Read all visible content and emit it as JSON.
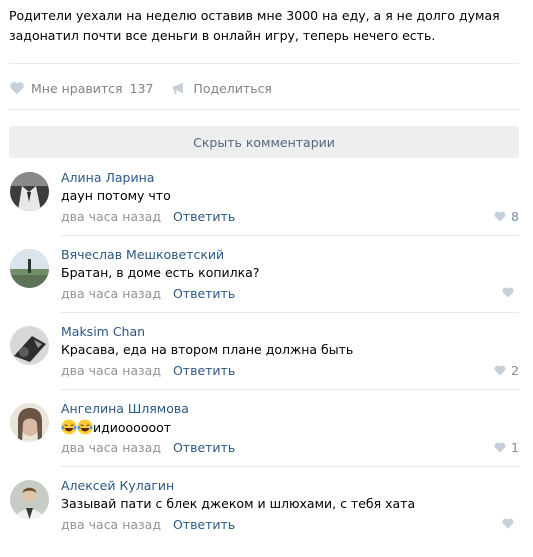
{
  "post": {
    "text_line1": "Родители уехали на неделю оставив мне 3000 на еду, а я не долго думая",
    "text_line2": "задонатил почти все деньги в онлайн игру, теперь нечего есть."
  },
  "actions": {
    "like_label": "Мне нравится",
    "like_count": "137",
    "share_label": "Поделиться"
  },
  "hide_comments_label": "Скрыть комментарии",
  "comments": [
    {
      "author": "Алина Ларина",
      "text": "даун потому что",
      "time": "два часа назад",
      "reply": "Ответить",
      "likes": "8"
    },
    {
      "author": "Вячеслав Мешковетский",
      "text": "Братан, в доме есть копилка?",
      "time": "два часа назад",
      "reply": "Ответить",
      "likes": ""
    },
    {
      "author": "Maksim Chan",
      "text": "Красава, еда на втором плане должна быть",
      "time": "два часа назад",
      "reply": "Ответить",
      "likes": "2"
    },
    {
      "author": "Ангелина Шлямова",
      "text": "идиоооооот",
      "time": "два часа назад",
      "reply": "Ответить",
      "likes": "1"
    },
    {
      "author": "Алексей Кулагин",
      "text": "Зазывай пати с блек джеком и шлюхами, с тебя хата",
      "time": "два часа назад",
      "reply": "Ответить",
      "likes": ""
    }
  ],
  "icons": {
    "like": "heart-icon",
    "share": "megaphone-icon",
    "emoji": "laughing-tears-emoji-icon"
  },
  "colors": {
    "link": "#2a5885",
    "meta": "#939393",
    "icon": "#c5d0db",
    "button_bg": "#edeef0"
  }
}
